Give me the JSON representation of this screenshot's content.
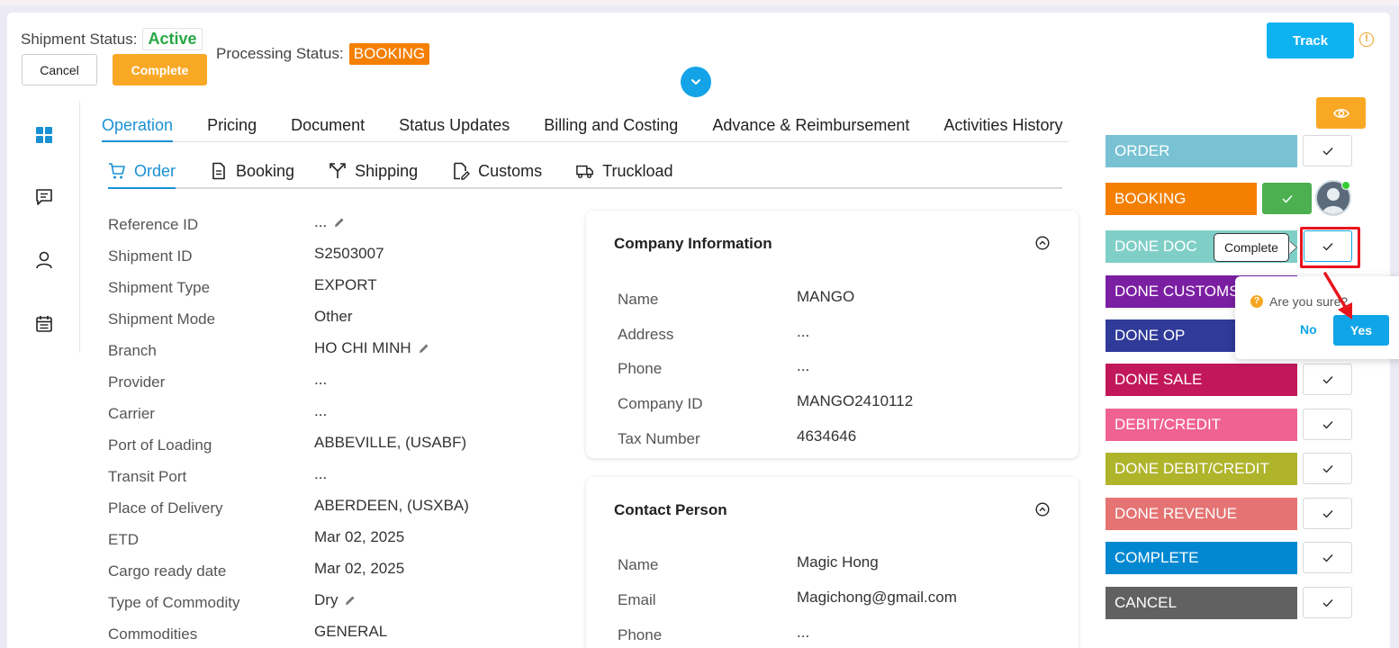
{
  "header": {
    "shipment_status_label": "Shipment Status:",
    "shipment_status_value": "Active",
    "processing_status_label": "Processing Status:",
    "processing_status_value": "BOOKING",
    "cancel_label": "Cancel",
    "complete_label": "Complete",
    "track_label": "Track"
  },
  "tabs": [
    "Operation",
    "Pricing",
    "Document",
    "Status Updates",
    "Billing and Costing",
    "Advance & Reimbursement",
    "Activities History"
  ],
  "subtabs": [
    "Order",
    "Booking",
    "Shipping",
    "Customs",
    "Truckload"
  ],
  "fields": [
    {
      "label": "Reference ID",
      "value": "..."
    },
    {
      "label": "Shipment ID",
      "value": "S2503007"
    },
    {
      "label": "Shipment Type",
      "value": "EXPORT"
    },
    {
      "label": "Shipment Mode",
      "value": "Other"
    },
    {
      "label": "Branch",
      "value": "HO CHI MINH"
    },
    {
      "label": "Provider",
      "value": "..."
    },
    {
      "label": "Carrier",
      "value": "..."
    },
    {
      "label": "Port of Loading",
      "value": "ABBEVILLE, (USABF)"
    },
    {
      "label": "Transit Port",
      "value": "..."
    },
    {
      "label": "Place of Delivery",
      "value": "ABERDEEN, (USXBA)"
    },
    {
      "label": "ETD",
      "value": "Mar 02, 2025"
    },
    {
      "label": "Cargo ready date",
      "value": "Mar 02, 2025"
    },
    {
      "label": "Type of Commodity",
      "value": "Dry"
    },
    {
      "label": "Commodities",
      "value": "GENERAL"
    }
  ],
  "company": {
    "title": "Company Information",
    "rows": [
      {
        "label": "Name",
        "value": "MANGO"
      },
      {
        "label": "Address",
        "value": "..."
      },
      {
        "label": "Phone",
        "value": "..."
      },
      {
        "label": "Company ID",
        "value": "MANGO2410112"
      },
      {
        "label": "Tax Number",
        "value": "4634646"
      }
    ]
  },
  "contact": {
    "title": "Contact Person",
    "rows": [
      {
        "label": "Name",
        "value": "Magic Hong"
      },
      {
        "label": "Email",
        "value": "Magichong@gmail.com"
      },
      {
        "label": "Phone",
        "value": "..."
      }
    ]
  },
  "statuses": [
    {
      "label": "ORDER",
      "color": "#78c2d3"
    },
    {
      "label": "BOOKING",
      "color": "#f47f00"
    },
    {
      "label": "DONE DOC",
      "color": "#7fcfc7"
    },
    {
      "label": "DONE CUSTOMS",
      "color": "#7b1fa2"
    },
    {
      "label": "DONE OP",
      "color": "#2f3a99"
    },
    {
      "label": "DONE SALE",
      "color": "#c2185b"
    },
    {
      "label": "DEBIT/CREDIT",
      "color": "#f06292"
    },
    {
      "label": "DONE DEBIT/CREDIT",
      "color": "#afb42b"
    },
    {
      "label": "DONE REVENUE",
      "color": "#e57373"
    },
    {
      "label": "COMPLETE",
      "color": "#0288d1"
    },
    {
      "label": "CANCEL",
      "color": "#616161"
    }
  ],
  "tooltip": "Complete",
  "confirm": {
    "question": "Are you sure?",
    "no_label": "No",
    "yes_label": "Yes"
  },
  "colors": {
    "accent": "#1a90d4",
    "track": "#0fb2f0",
    "warning": "#f9a825",
    "active_green": "#28a745",
    "done_green": "#4caf50",
    "highlight_red": "#e8141c"
  }
}
